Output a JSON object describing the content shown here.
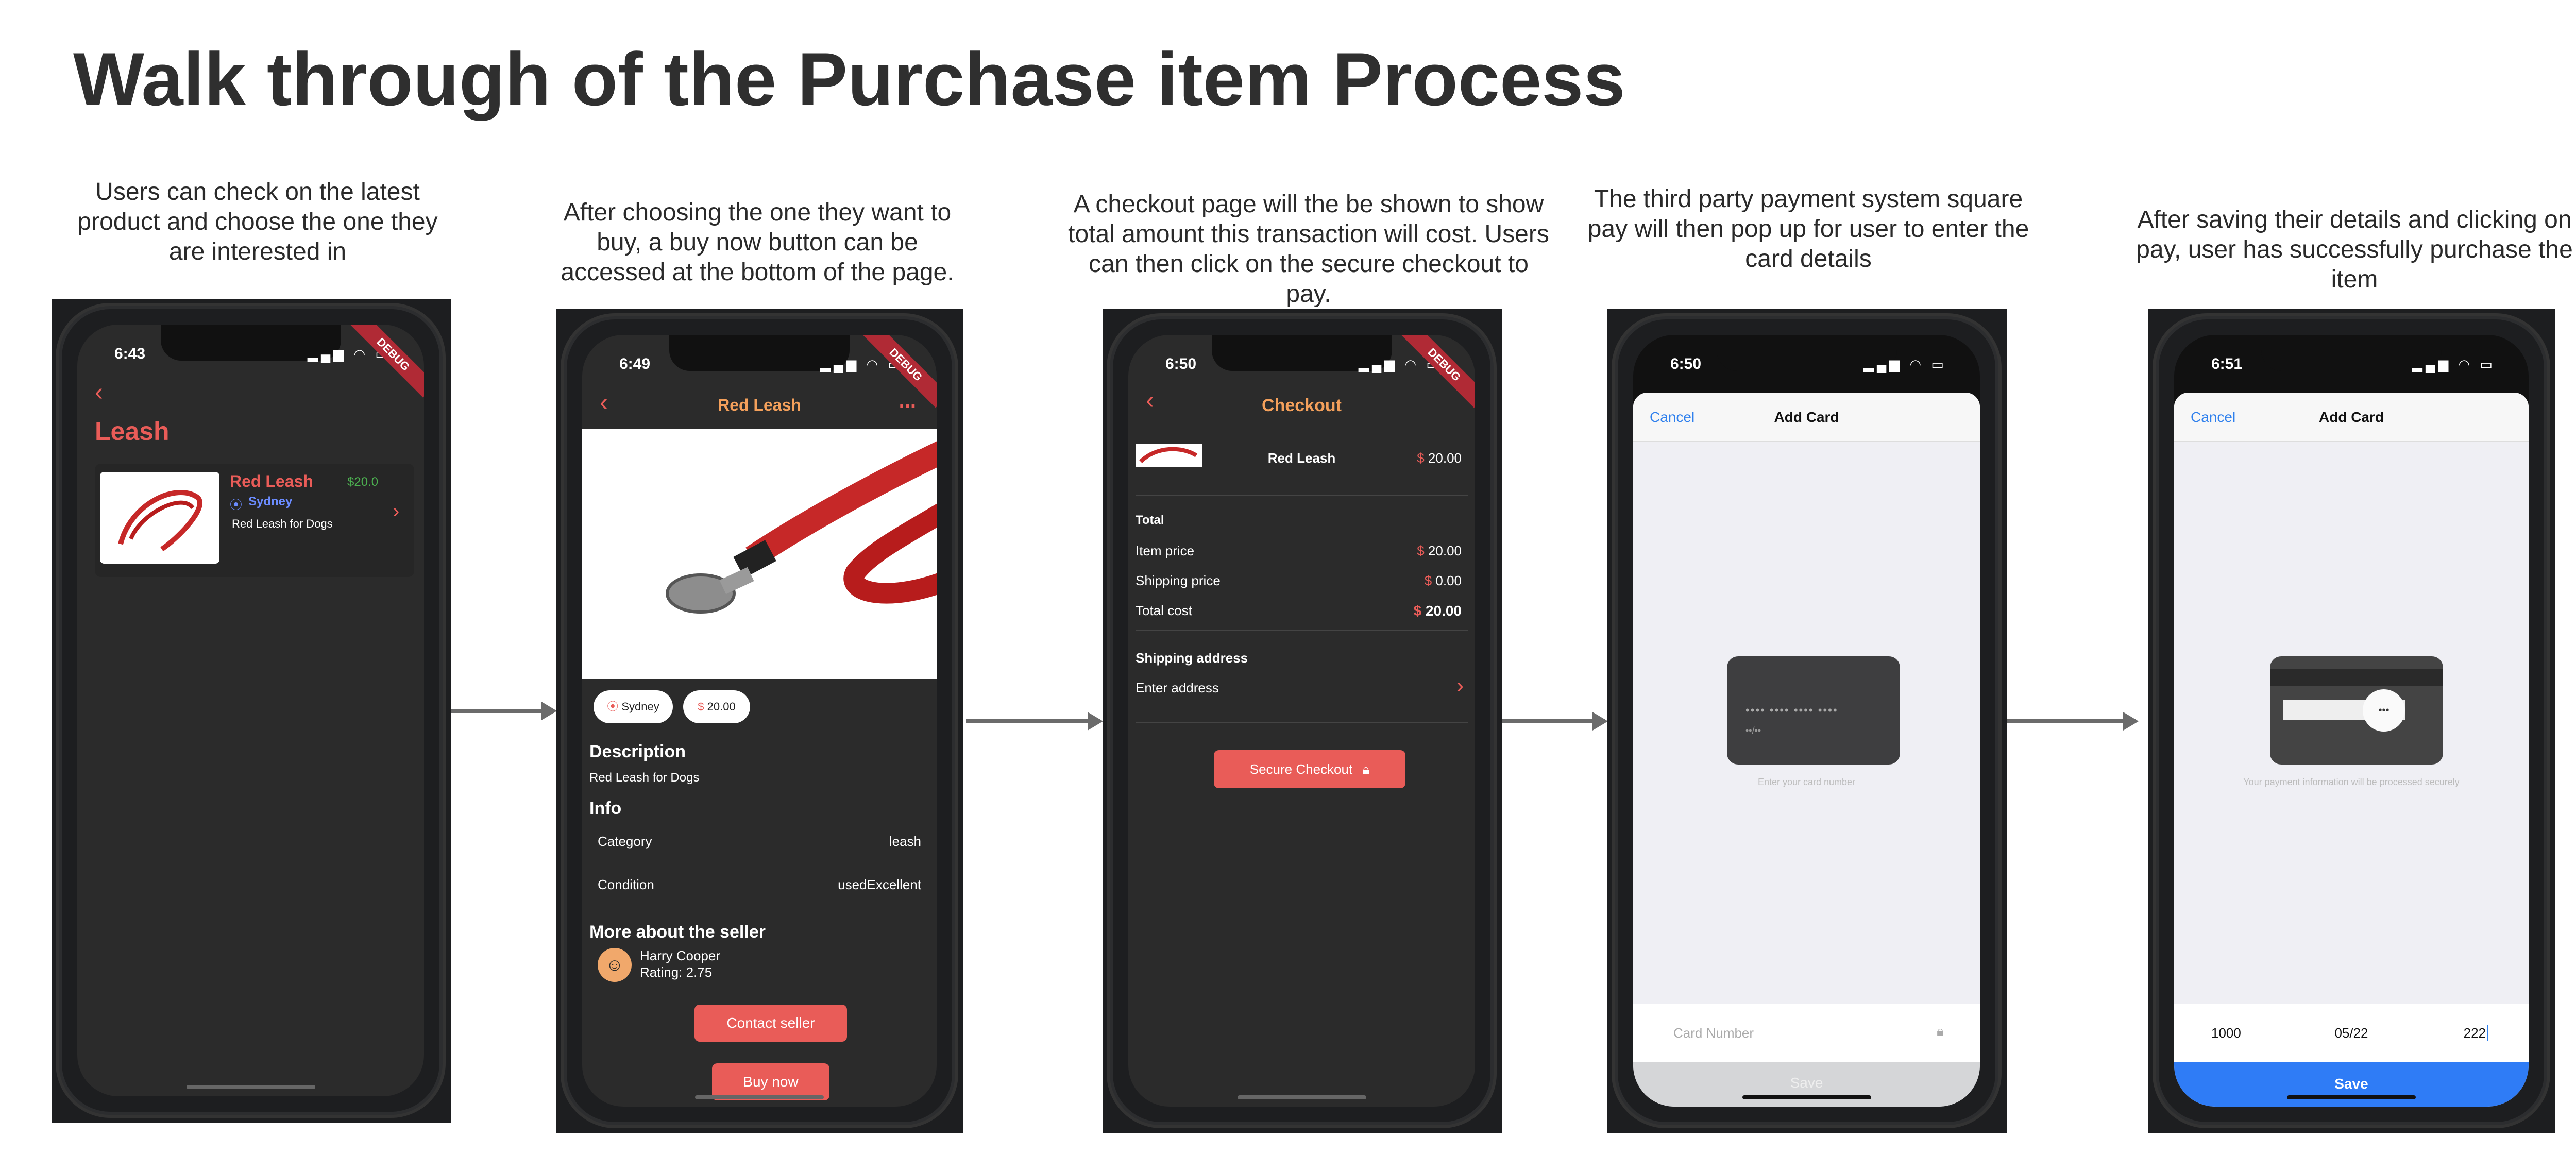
{
  "title": "Walk through of the Purchase item Process",
  "captions": [
    "Users can check on the latest product and choose the one they are interested in",
    "After choosing the one they want to buy, a buy now button can be accessed at the bottom of the page.",
    "A checkout page will the be shown to show total amount this transaction will cost. Users can then click on the secure checkout to pay.",
    "The third party payment system square pay will then pop up for user to enter the card details",
    "After saving their details and clicking on pay, user has successfully purchase the item"
  ],
  "banner_text": "DEBUG",
  "screen1": {
    "time": "6:43",
    "page_title": "Leash",
    "item": {
      "name": "Red Leash",
      "price": "$20.0",
      "location": "Sydney",
      "description": "Red Leash for Dogs"
    }
  },
  "screen2": {
    "time": "6:49",
    "header_title": "Red Leash",
    "menu": "...",
    "location_chip": "Sydney",
    "price_chip": "20.00",
    "currency": "$",
    "description_heading": "Description",
    "description": "Red Leash for Dogs",
    "info_heading": "Info",
    "category_label": "Category",
    "category_value": "leash",
    "condition_label": "Condition",
    "condition_value": "usedExcellent",
    "seller_heading": "More about the seller",
    "seller_name": "Harry Cooper",
    "seller_rating": "Rating: 2.75",
    "contact_button": "Contact seller",
    "buy_button": "Buy now"
  },
  "screen3": {
    "time": "6:50",
    "header_title": "Checkout",
    "item_name": "Red Leash",
    "currency": "$",
    "item_price": "20.00",
    "total_heading": "Total",
    "item_price_label": "Item price",
    "item_price_value": "20.00",
    "shipping_label": "Shipping price",
    "shipping_value": "0.00",
    "total_label": "Total cost",
    "total_value": "20.00",
    "address_heading": "Shipping address",
    "address_placeholder": "Enter address",
    "checkout_button": "Secure Checkout"
  },
  "screen4": {
    "time": "6:50",
    "cancel": "Cancel",
    "sheet_title": "Add Card",
    "card_masked": "•••• •••• •••• ••••",
    "card_masked2": "••/••",
    "hint": "Enter your card number",
    "card_placeholder": "Card Number",
    "save": "Save"
  },
  "screen5": {
    "time": "6:51",
    "cancel": "Cancel",
    "sheet_title": "Add Card",
    "hint": "Your payment information will be processed securely",
    "card_number": "1000",
    "expiry": "05/22",
    "cvv": "222",
    "save": "Save"
  }
}
